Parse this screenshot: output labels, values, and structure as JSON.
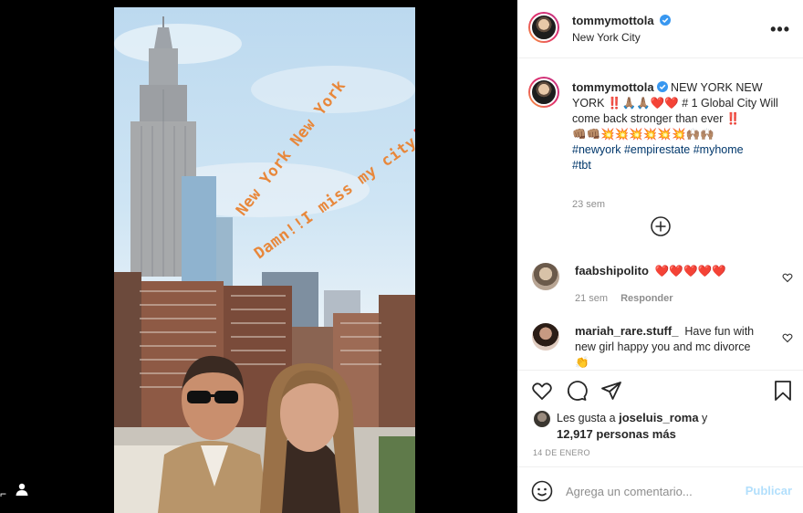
{
  "post": {
    "author": "tommymottola",
    "location": "New York City",
    "story_text_line1": "New York New York",
    "story_text_line2": "Damn!!I miss my city‼️"
  },
  "caption": {
    "username": "tommymottola",
    "text_line1": "NEW YORK NEW YORK ‼️🙏🏽🙏🏽❤️❤️ # 1 Global City Will come back stronger than ever ‼️",
    "emojis": "👊🏽👊🏽💥💥💥💥💥💥🙌🏽🙌🏽",
    "hashtags": [
      "#newyork",
      "#empirestate",
      "#myhome",
      "#tbt"
    ],
    "time": "23 sem"
  },
  "comments": [
    {
      "username": "faabshipolito",
      "text": "❤️❤️❤️❤️❤️",
      "time": "21 sem",
      "reply_label": "Responder"
    },
    {
      "username": "mariah_rare.stuff_",
      "text": "Have fun with new girl happy you and mc divorce 👏"
    }
  ],
  "likes": {
    "prefix": "Les gusta a",
    "user": "joseluis_roma",
    "joiner": "y",
    "count_text": "12,917 personas más"
  },
  "date": "14 DE ENERO",
  "add_comment": {
    "placeholder": "Agrega un comentario...",
    "post_label": "Publicar"
  },
  "icons": {
    "more": "more-options-icon",
    "load_more": "plus-circle-icon",
    "like": "heart-icon",
    "comment": "comment-icon",
    "share": "share-icon",
    "save": "bookmark-icon",
    "emoji": "smile-icon",
    "tagged": "user-tag-icon"
  },
  "colors": {
    "link": "#00376b",
    "verified": "#3897f0",
    "post_button_disabled": "#b2dffc",
    "story_text": "#e8873a"
  }
}
